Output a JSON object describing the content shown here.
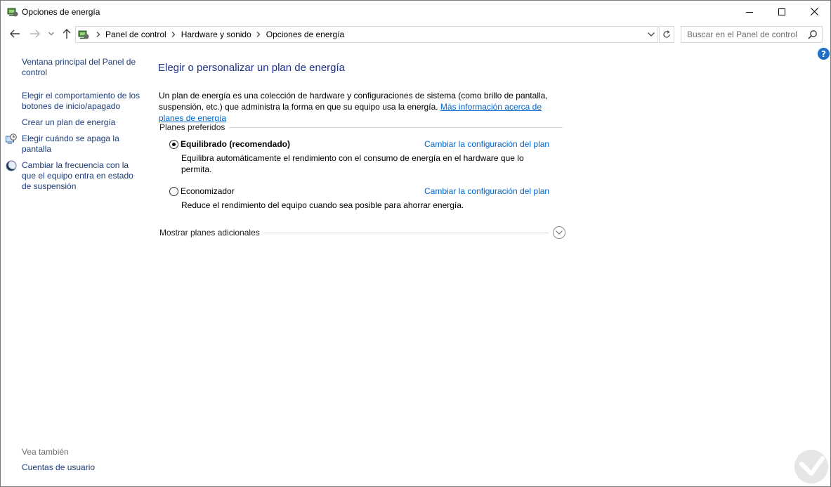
{
  "window": {
    "title": "Opciones de energía"
  },
  "nav": {
    "breadcrumbs": [
      "Panel de control",
      "Hardware y sonido",
      "Opciones de energía"
    ],
    "search_placeholder": "Buscar en el Panel de control"
  },
  "sidebar": {
    "items": [
      {
        "label": "Ventana principal del Panel de control"
      },
      {
        "label": "Elegir el comportamiento de los botones de inicio/apagado"
      },
      {
        "label": "Crear un plan de energía"
      },
      {
        "label": "Elegir cuándo se apaga la pantalla",
        "icon": "clock-monitor-icon"
      },
      {
        "label": "Cambiar la frecuencia con la que el equipo entra en estado de suspensión",
        "icon": "moon-icon"
      }
    ],
    "see_also_heading": "Vea también",
    "see_also_items": [
      {
        "label": "Cuentas de usuario"
      }
    ]
  },
  "main": {
    "title": "Elegir o personalizar un plan de energía",
    "intro_text": "Un plan de energía es una colección de hardware y configuraciones de sistema (como brillo de pantalla, suspensión, etc.) que administra la forma en que su equipo usa la energía.",
    "intro_link": "Más información acerca de planes de energía",
    "section_heading": "Planes preferidos",
    "plans": [
      {
        "name": "Equilibrado (recomendado)",
        "selected": true,
        "change_link": "Cambiar la configuración del plan",
        "description": "Equilibra automáticamente el rendimiento con el consumo de energía en el hardware que lo permita."
      },
      {
        "name": "Economizador",
        "selected": false,
        "change_link": "Cambiar la configuración del plan",
        "description": "Reduce el rendimiento del equipo cuando sea posible para ahorrar energía."
      }
    ],
    "more_plans_label": "Mostrar planes adicionales"
  },
  "colors": {
    "title_blue": "#1e3287",
    "link_blue": "#0066cc",
    "sidebar_link": "#1b3b78",
    "help_blue": "#1e6fc5"
  },
  "help": {
    "glyph": "?"
  }
}
